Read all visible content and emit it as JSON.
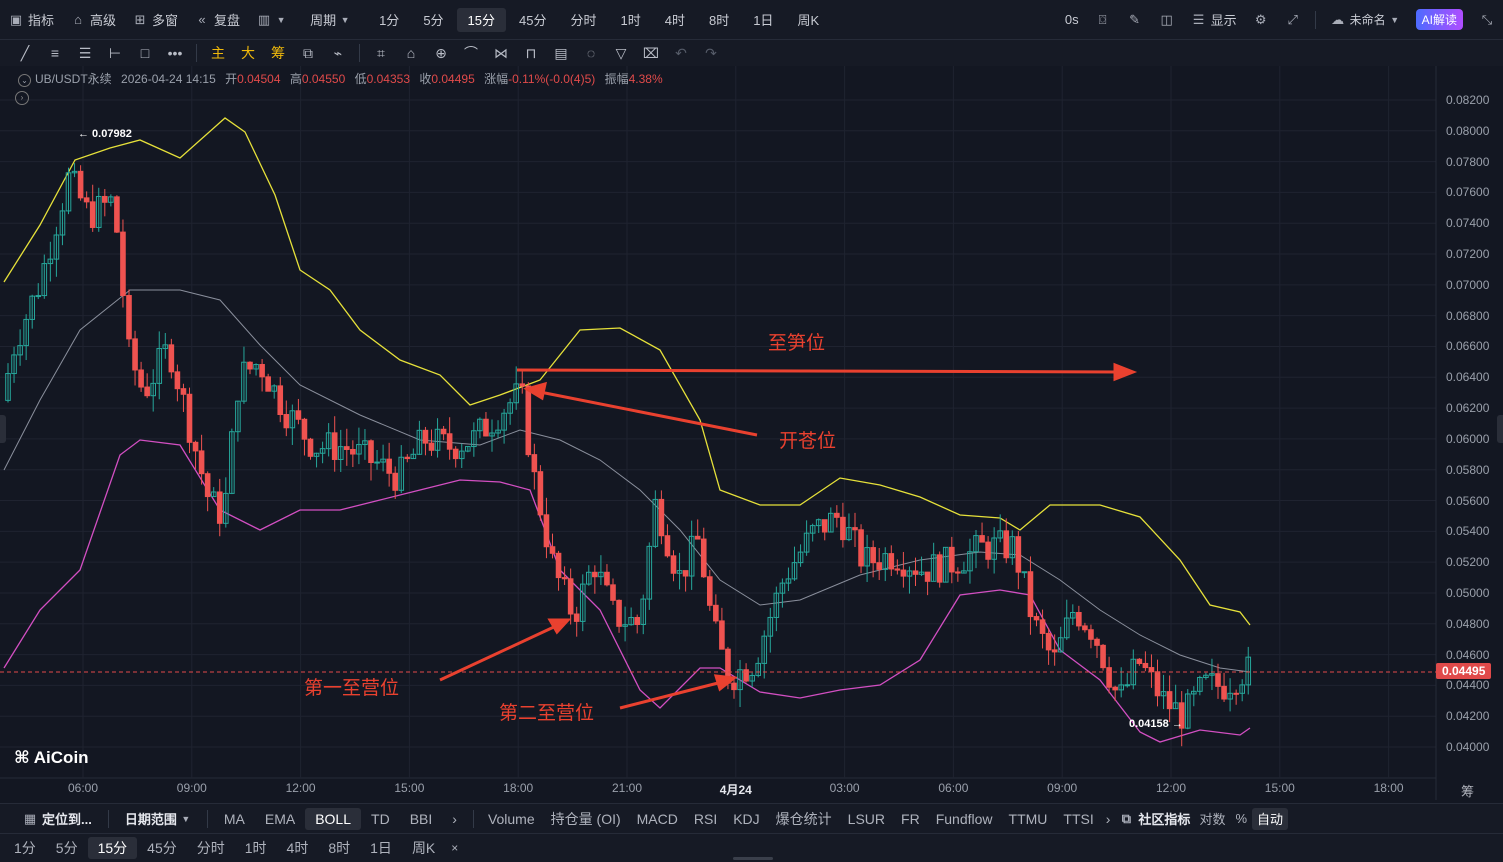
{
  "topbar": {
    "indicators": "指标",
    "advanced": "高级",
    "multi": "多窗",
    "replay": "复盘",
    "period": "周期",
    "timeframes": [
      "1分",
      "5分",
      "15分",
      "45分",
      "分时",
      "1时",
      "4时",
      "8时",
      "1日",
      "周K"
    ],
    "active_timeframe": "15分",
    "countdown": "0s",
    "display": "显示",
    "account": "未命名",
    "ai_button": "AI解读"
  },
  "drawbar": {
    "chars": [
      "主",
      "大",
      "筹"
    ]
  },
  "infoline": {
    "symbol": "UB/USDT永续",
    "datetime": "2026-04-24 14:15",
    "open_label": "开",
    "open": "0.04504",
    "high_label": "高",
    "high": "0.04550",
    "low_label": "低",
    "low": "0.04353",
    "close_label": "收",
    "close": "0.04495",
    "change_label": "涨幅",
    "change": "-0.11%(-0.0(4)5)",
    "amp_label": "振幅",
    "amp": "4.38%"
  },
  "annotations": {
    "take_profit": "至笋位",
    "open_position": "开苍位",
    "first_target": "第一至营位",
    "second_target": "第二至营位"
  },
  "chart_labels": {
    "high_marker": "← 0.07982",
    "low_marker": "0.04158 →",
    "last_price": "0.04495",
    "brand": "AiCoin",
    "right_corner": "筹"
  },
  "chart_data": {
    "type": "candlestick",
    "y_ticks": [
      "0.08200",
      "0.08000",
      "0.07800",
      "0.07600",
      "0.07400",
      "0.07200",
      "0.07000",
      "0.06800",
      "0.06600",
      "0.06400",
      "0.06200",
      "0.06000",
      "0.05800",
      "0.05600",
      "0.05400",
      "0.05200",
      "0.05000",
      "0.04800",
      "0.04600",
      "0.04400",
      "0.04200",
      "0.04000"
    ],
    "ylim": [
      0.0392,
      0.083
    ],
    "x_ticks": [
      "06:00",
      "09:00",
      "12:00",
      "15:00",
      "18:00",
      "21:00",
      "4月24",
      "03:00",
      "06:00",
      "09:00",
      "12:00",
      "15:00",
      "18:00"
    ],
    "indicator": "BOLL",
    "last_price": 0.04495,
    "period_high": 0.07982,
    "period_low": 0.04158,
    "grid": true
  },
  "bottombar1": {
    "locate": "定位到...",
    "date_range": "日期范围",
    "main_indicators": [
      "MA",
      "EMA",
      "BOLL",
      "TD",
      "BBI"
    ],
    "active_main": "BOLL",
    "sub_indicators": [
      "Volume",
      "持仓量 (OI)",
      "MACD",
      "RSI",
      "KDJ",
      "爆仓统计",
      "LSUR",
      "FR",
      "Fundflow",
      "TTMU",
      "TTSI"
    ],
    "community": "社区指标",
    "log": "对数",
    "percent": "%",
    "auto": "自动"
  },
  "bottombar2": {
    "timeframes": [
      "1分",
      "5分",
      "15分",
      "45分",
      "分时",
      "1时",
      "4时",
      "8时",
      "1日",
      "周K"
    ],
    "active": "15分",
    "close": "×"
  }
}
